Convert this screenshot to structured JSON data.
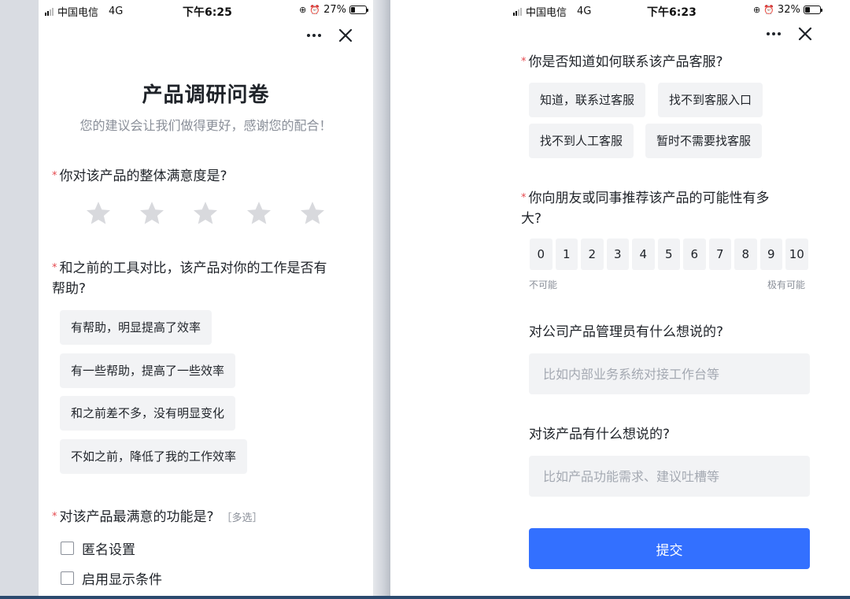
{
  "left_screen": {
    "status_bar": {
      "carrier": "中国电信",
      "network": "4G",
      "time": "下午6:25",
      "battery_percent": "27%",
      "battery_level": 0.27
    },
    "title": "产品调研问卷",
    "subtitle": "您的建议会让我们做得更好，感谢您的配合！",
    "questions": [
      {
        "required_mark": "*",
        "text": "你对该产品的整体满意度是?",
        "type": "rating",
        "stars_total": 5,
        "stars_selected": 0
      },
      {
        "required_mark": "*",
        "text_line1": "和之前的工具对比，该产品对你的工作是否有",
        "text_line2": "帮助?",
        "options": [
          "有帮助，明显提高了效率",
          "有一些帮助，提高了一些效率",
          "和之前差不多，没有明显变化",
          "不如之前，降低了我的工作效率"
        ]
      },
      {
        "required_mark": "*",
        "text": "对该产品最满意的功能是?",
        "tag": "［多选］",
        "options": [
          "匿名设置",
          "启用显示条件"
        ]
      }
    ]
  },
  "right_screen": {
    "status_bar": {
      "carrier": "中国电信",
      "network": "4G",
      "time": "下午6:23",
      "battery_percent": "32%",
      "battery_level": 0.32
    },
    "questions": [
      {
        "required_mark": "*",
        "text": "你是否知道如何联系该产品客服?",
        "options": [
          "知道，联系过客服",
          "找不到客服入口",
          "找不到人工客服",
          "暂时不需要找客服"
        ]
      },
      {
        "required_mark": "*",
        "text_line1": "你向朋友或同事推荐该产品的可能性有多",
        "text_line2": "大?",
        "scale": [
          "0",
          "1",
          "2",
          "3",
          "4",
          "5",
          "6",
          "7",
          "8",
          "9",
          "10"
        ],
        "low_label": "不可能",
        "high_label": "极有可能"
      },
      {
        "text": "对公司产品管理员有什么想说的?",
        "placeholder": "比如内部业务系统对接工作台等"
      },
      {
        "text": "对该产品有什么想说的?",
        "placeholder": "比如产品功能需求、建议吐槽等"
      }
    ],
    "submit_label": "提交"
  },
  "colors": {
    "accent": "#3370ff",
    "required": "#e5484d",
    "chip_bg": "#f2f3f5",
    "muted_text": "#8a8f99",
    "star": "#d8d9dd"
  },
  "icons": [
    "signal-icon",
    "alarm-icon",
    "battery-icon",
    "more-icon",
    "close-icon",
    "star-icon"
  ]
}
